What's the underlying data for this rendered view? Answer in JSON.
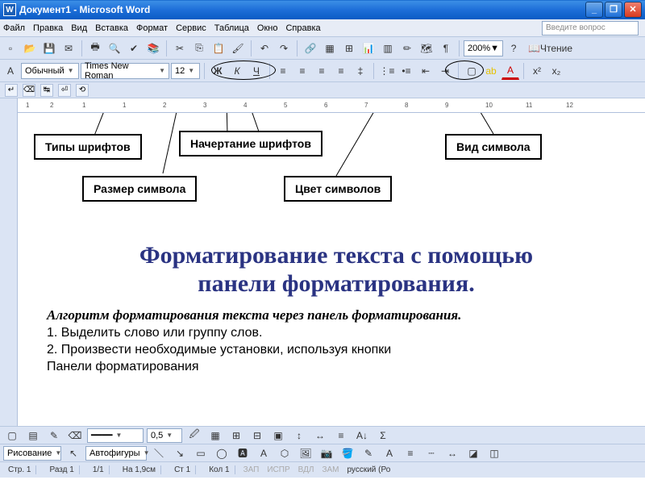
{
  "window": {
    "title": "Документ1 - Microsoft Word",
    "app_icon": "W"
  },
  "menu": {
    "items": [
      "Файл",
      "Правка",
      "Вид",
      "Вставка",
      "Формат",
      "Сервис",
      "Таблица",
      "Окно",
      "Справка"
    ]
  },
  "toolbar1": {
    "zoom": "200%",
    "read_label": "Чтение",
    "search_placeholder": "Введите вопрос"
  },
  "toolbar2": {
    "style": "Обычный",
    "font": "Times New Roman",
    "size": "12",
    "bold": "Ж",
    "italic": "К",
    "underline": "Ч"
  },
  "ruler": {
    "ticks": [
      "1",
      "2",
      "1",
      "1",
      "2",
      "3",
      "4",
      "5",
      "6",
      "7",
      "8",
      "9",
      "10",
      "11",
      "12"
    ]
  },
  "annotations": {
    "font_types": "Типы шрифтов",
    "font_style": "Начертание шрифтов",
    "symbol_view": "Вид символа",
    "symbol_size": "Размер символа",
    "symbol_color": "Цвет символов"
  },
  "document": {
    "title_line1": "Форматирование текста с помощью",
    "title_line2": "панели форматирования.",
    "subtitle": "Алгоритм форматирования текста через панель форматирования.",
    "step1": "1. Выделить слово или группу слов.",
    "step2": "2. Произвести необходимые установки, используя кнопки",
    "step3": "Панели форматирования"
  },
  "bottom_tb1": {
    "val": "0,5"
  },
  "bottom_tb2": {
    "draw_label": "Рисование",
    "autoshapes": "Автофигуры"
  },
  "status": {
    "page": "Стр. 1",
    "section": "Разд 1",
    "pages": "1/1",
    "at": "На 1,9см",
    "line": "Ст 1",
    "col": "Кол 1",
    "rec": "ЗАП",
    "fix": "ИСПР",
    "ext": "ВДЛ",
    "ovr": "ЗАМ",
    "lang": "русский (Ро"
  }
}
